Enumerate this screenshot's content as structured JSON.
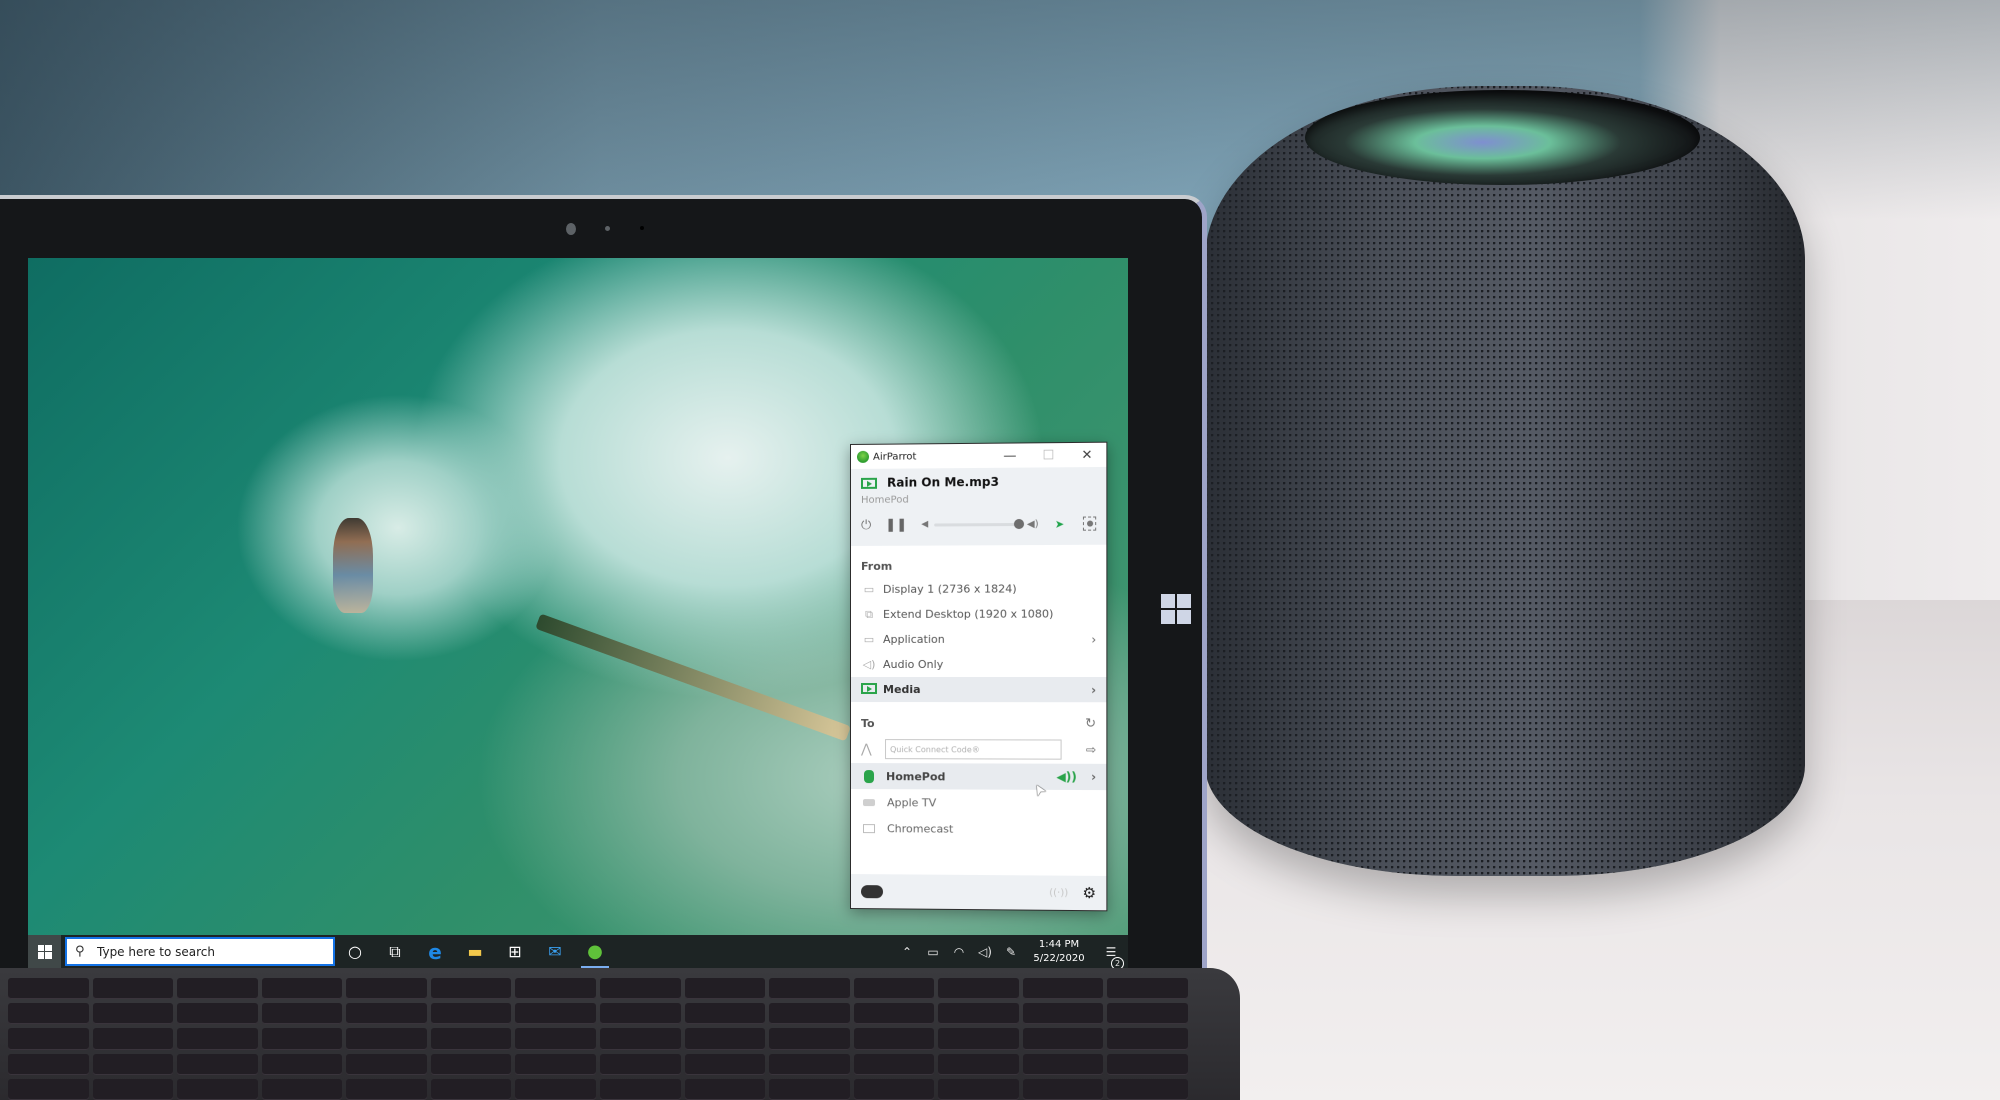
{
  "airparrot": {
    "app_title": "AirParrot",
    "window_controls": {
      "minimize": "—",
      "maximize": "☐",
      "close": "✕"
    },
    "now_playing": {
      "track": "Rain On Me.mp3",
      "device": "HomePod",
      "volume_percent": 100,
      "power_icon": "⏻",
      "pause_icon": "❚❚",
      "vol_low_icon": "◀",
      "vol_high_icon": "◀)",
      "cursor_icon": "➤"
    },
    "from": {
      "heading": "From",
      "items": [
        {
          "label": "Display 1 (2736 x 1824)",
          "icon": "▭",
          "chevron": ""
        },
        {
          "label": "Extend Desktop (1920 x 1080)",
          "icon": "⧉",
          "chevron": ""
        },
        {
          "label": "Application",
          "icon": "▭",
          "chevron": "›"
        },
        {
          "label": "Audio Only",
          "icon": "◁)",
          "chevron": ""
        },
        {
          "label": "Media",
          "icon": "",
          "chevron": "›",
          "selected": true
        }
      ]
    },
    "to": {
      "heading": "To",
      "refresh_icon": "↻",
      "quick_connect_placeholder": "Quick Connect Code®",
      "quick_connect_value": "",
      "network_icon": "⋀",
      "go_icon": "⇨",
      "devices": [
        {
          "label": "HomePod",
          "selected": true,
          "speaker_icon": "◀))",
          "chevron": "›"
        },
        {
          "label": "Apple TV"
        },
        {
          "label": "Chromecast"
        }
      ]
    },
    "footer": {
      "antenna_icon": "((·))",
      "gear_icon": "⚙"
    }
  },
  "taskbar": {
    "search_placeholder": "Type here to search",
    "search_icon": "⚲",
    "cortana_icon": "○",
    "task_view_icon": "⧉",
    "edge_icon": "e",
    "explorer_icon": "▬",
    "store_icon": "⊞",
    "mail_icon": "✉",
    "airparrot_icon": "●",
    "tray": {
      "chevron_icon": "⌃",
      "battery_icon": "▭",
      "wifi_icon": "◠",
      "volume_icon": "◁)",
      "pen_icon": "✎",
      "time": "1:44 PM",
      "date": "5/22/2020",
      "notifications_icon": "☰",
      "notifications_count": "2"
    }
  },
  "colors": {
    "accent_green": "#2aa44a",
    "taskbar_bg": "#1d2424",
    "search_border": "#1473e6",
    "panel_bg": "#eef1f4"
  }
}
